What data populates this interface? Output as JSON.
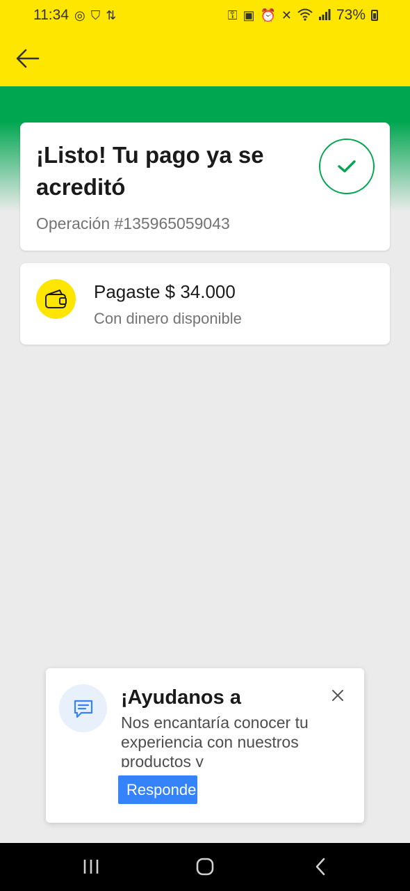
{
  "status_bar": {
    "time": "11:34",
    "battery": "73%",
    "left_icons": [
      "whatsapp-icon",
      "shield-icon",
      "sync-icon"
    ],
    "right_icons": [
      "key-icon",
      "lock-icon",
      "alarm-icon",
      "mute-icon",
      "wifi-icon",
      "signal-icon",
      "battery-icon"
    ]
  },
  "header": {
    "back_icon": "arrow-left-icon",
    "background_color": "#ffe600"
  },
  "success_card": {
    "title": "¡Listo! Tu pago ya se acreditó",
    "operation": "Operación #135965059043",
    "status_icon": "check-icon",
    "accent_color": "#00a650"
  },
  "payment_card": {
    "amount_text": "Pagaste $ 34.000",
    "method_text": "Con dinero disponible",
    "icon": "wallet-icon"
  },
  "survey": {
    "icon": "chat-icon",
    "title": "¡Ayudanos a",
    "body": "Nos encantaría conocer tu experiencia con nuestros productos y",
    "button_label": "Responde",
    "close_icon": "close-icon",
    "button_color": "#3483fa"
  },
  "nav_bar": {
    "recents_icon": "recents-icon",
    "home_icon": "home-icon",
    "back_icon": "back-chevron-icon"
  }
}
